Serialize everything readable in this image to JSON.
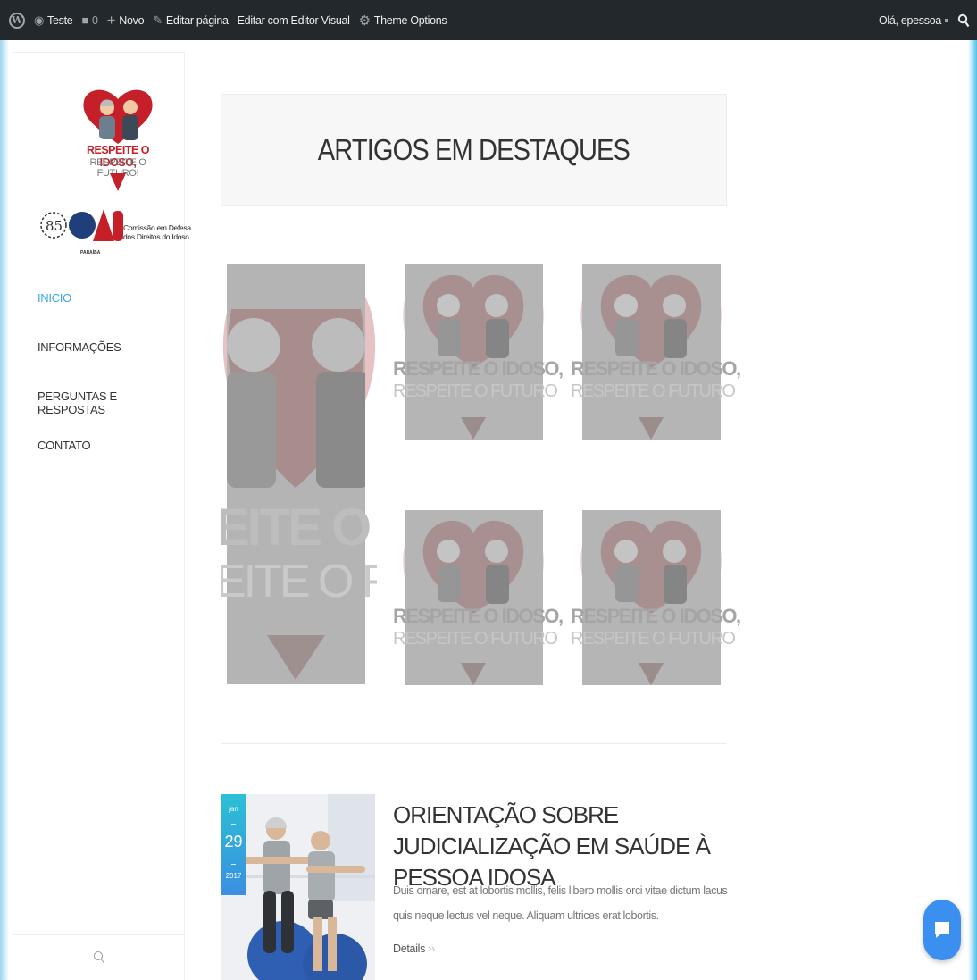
{
  "admin_bar": {
    "site_name": "Teste",
    "comments_count": "0",
    "new_label": "Novo",
    "edit_page": "Editar página",
    "edit_visual": "Editar com Editor Visual",
    "theme_options": "Theme Options",
    "greeting": "Olá, epessoa"
  },
  "logos": {
    "campaign_line1": "RESPEITE O IDOSO,",
    "campaign_line2": "RESPEITE O FUTURO!",
    "oab_number": "85",
    "oab_name": "OAB",
    "commission_line1": "Comissão em Defesa",
    "commission_line2": "dos Direitos do Idoso",
    "state": "PARAÍBA"
  },
  "nav": {
    "items": [
      {
        "label": "INICIO",
        "active": true
      },
      {
        "label": "INFORMAÇÕES",
        "active": false
      },
      {
        "label": "PERGUNTAS E RESPOSTAS",
        "active": false
      },
      {
        "label": "CONTATO",
        "active": false
      }
    ]
  },
  "featured": {
    "heading": "ARTIGOS EM DESTAQUES",
    "ghost_line1": "RESPEITE O IDOSO,",
    "ghost_line2": "RESPEITE O FUTURO",
    "ghost_big1": "EITE O ID",
    "ghost_big2": "EITE O FU"
  },
  "post": {
    "month": "jan",
    "day": "29",
    "year": "2017",
    "title": "ORIENTAÇÃO SOBRE JUDICIALIZAÇÃO EM SAÚDE À PESSOA IDOSA",
    "excerpt": "Duis ornare, est at lobortis mollis, felis libero mollis orci vitae dictum lacus quis neque lectus vel neque. Aliquam ultrices erat lobortis.",
    "details_label": "Details"
  },
  "colors": {
    "accent": "#3aa6e3",
    "admin_bar": "#23282d",
    "campaign_red": "#c51f2a",
    "chat_button": "#3b8ff0"
  },
  "icons": {
    "wp": "wordpress-icon",
    "site": "home-icon",
    "comments": "comment-icon",
    "new": "plus-icon",
    "edit": "pencil-icon",
    "theme": "gear-icon",
    "search": "search-icon",
    "chat": "chat-icon"
  }
}
